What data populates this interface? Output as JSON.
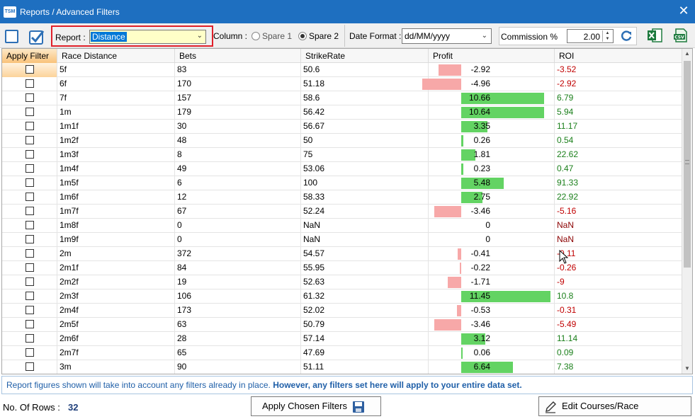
{
  "window": {
    "app_icon": "TSM",
    "title": "Reports / Advanced Filters"
  },
  "toolbar": {
    "report_label": "Report :",
    "report_value": "Distance",
    "column_label": "Column :",
    "spare1": "Spare 1",
    "spare2": "Spare 2",
    "date_label": "Date Format :",
    "date_value": "dd/MM/yyyy",
    "commission_label": "Commission %",
    "commission_value": "2.00"
  },
  "table": {
    "headers": [
      "Apply Filter",
      "Race Distance",
      "Bets",
      "StrikeRate",
      "Profit",
      "ROI"
    ],
    "rows": [
      {
        "dist": "5f",
        "bets": "83",
        "sr": "50.6",
        "profit": "-2.92",
        "roi": "-3.52"
      },
      {
        "dist": "6f",
        "bets": "170",
        "sr": "51.18",
        "profit": "-4.96",
        "roi": "-2.92"
      },
      {
        "dist": "7f",
        "bets": "157",
        "sr": "58.6",
        "profit": "10.66",
        "roi": "6.79"
      },
      {
        "dist": "1m",
        "bets": "179",
        "sr": "56.42",
        "profit": "10.64",
        "roi": "5.94"
      },
      {
        "dist": "1m1f",
        "bets": "30",
        "sr": "56.67",
        "profit": "3.35",
        "roi": "11.17"
      },
      {
        "dist": "1m2f",
        "bets": "48",
        "sr": "50",
        "profit": "0.26",
        "roi": "0.54"
      },
      {
        "dist": "1m3f",
        "bets": "8",
        "sr": "75",
        "profit": "1.81",
        "roi": "22.62"
      },
      {
        "dist": "1m4f",
        "bets": "49",
        "sr": "53.06",
        "profit": "0.23",
        "roi": "0.47"
      },
      {
        "dist": "1m5f",
        "bets": "6",
        "sr": "100",
        "profit": "5.48",
        "roi": "91.33"
      },
      {
        "dist": "1m6f",
        "bets": "12",
        "sr": "58.33",
        "profit": "2.75",
        "roi": "22.92"
      },
      {
        "dist": "1m7f",
        "bets": "67",
        "sr": "52.24",
        "profit": "-3.46",
        "roi": "-5.16"
      },
      {
        "dist": "1m8f",
        "bets": "0",
        "sr": "NaN",
        "profit": "0",
        "roi": "NaN"
      },
      {
        "dist": "1m9f",
        "bets": "0",
        "sr": "NaN",
        "profit": "0",
        "roi": "NaN"
      },
      {
        "dist": "2m",
        "bets": "372",
        "sr": "54.57",
        "profit": "-0.41",
        "roi": "-0.11"
      },
      {
        "dist": "2m1f",
        "bets": "84",
        "sr": "55.95",
        "profit": "-0.22",
        "roi": "-0.26"
      },
      {
        "dist": "2m2f",
        "bets": "19",
        "sr": "52.63",
        "profit": "-1.71",
        "roi": "-9"
      },
      {
        "dist": "2m3f",
        "bets": "106",
        "sr": "61.32",
        "profit": "11.45",
        "roi": "10.8"
      },
      {
        "dist": "2m4f",
        "bets": "173",
        "sr": "52.02",
        "profit": "-0.53",
        "roi": "-0.31"
      },
      {
        "dist": "2m5f",
        "bets": "63",
        "sr": "50.79",
        "profit": "-3.46",
        "roi": "-5.49"
      },
      {
        "dist": "2m6f",
        "bets": "28",
        "sr": "57.14",
        "profit": "3.12",
        "roi": "11.14"
      },
      {
        "dist": "2m7f",
        "bets": "65",
        "sr": "47.69",
        "profit": "0.06",
        "roi": "0.09"
      },
      {
        "dist": "3m",
        "bets": "90",
        "sr": "51.11",
        "profit": "6.64",
        "roi": "7.38"
      }
    ]
  },
  "notice": {
    "normal": "Report figures shown will take into account any filters already in place.",
    "bold": "However, any filters set here will apply to your entire data set."
  },
  "footer": {
    "rows_label": "No. Of Rows  :",
    "rows_value": "32",
    "apply_button": "Apply Chosen Filters",
    "edit_button": "Edit Courses/Race Type/Custom"
  },
  "colors": {
    "titlebar": "#1e6fc0",
    "positive_bar": "#63d363",
    "negative_bar": "#f7a8a8",
    "report_highlight": "#e0202a"
  },
  "icons": [
    "close-icon",
    "checkbox-empty-icon",
    "checkbox-checked-icon",
    "chevron-down-icon",
    "refresh-icon",
    "excel-icon",
    "csv-icon",
    "save-icon",
    "pencil-icon"
  ]
}
